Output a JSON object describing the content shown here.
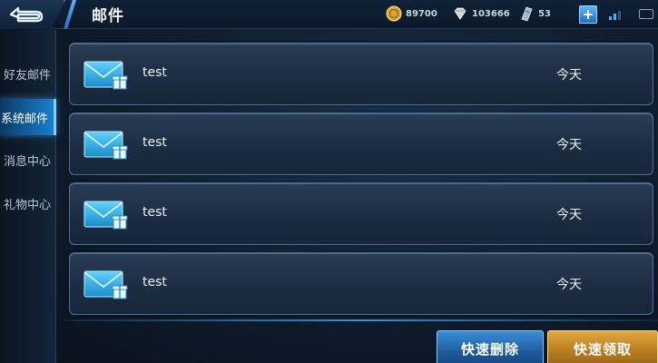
{
  "header": {
    "title": "邮件",
    "back_icon": "back-arrow-icon"
  },
  "resources": {
    "gold": {
      "icon": "gold-coin-icon",
      "value": "89700"
    },
    "diamond": {
      "icon": "diamond-icon",
      "value": "103666"
    },
    "ticket": {
      "icon": "ticket-icon",
      "value": "53"
    },
    "add_icon": "plus-icon"
  },
  "sidebar": {
    "tabs": [
      {
        "label": "好友邮件"
      },
      {
        "label": "系统邮件",
        "active": true
      },
      {
        "label": "消息中心"
      },
      {
        "label": "礼物中心"
      }
    ]
  },
  "mails": [
    {
      "subject": "test",
      "date": "今天",
      "icon": "mail-gift-icon"
    },
    {
      "subject": "test",
      "date": "今天",
      "icon": "mail-gift-icon"
    },
    {
      "subject": "test",
      "date": "今天",
      "icon": "mail-gift-icon"
    },
    {
      "subject": "test",
      "date": "今天",
      "icon": "mail-gift-icon"
    }
  ],
  "actions": {
    "delete_label": "快速删除",
    "claim_label": "快速领取"
  },
  "colors": {
    "accent_blue": "#1a7fd0",
    "claim_gold": "#e0a842",
    "panel_border": "#4b7398"
  }
}
